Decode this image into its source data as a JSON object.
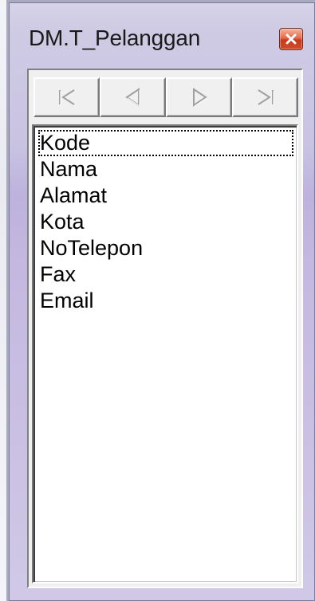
{
  "window": {
    "title": "DM.T_Pelanggan",
    "close_icon": "close-x-icon",
    "close_color": "#d9502e"
  },
  "navigator": {
    "buttons": [
      {
        "name": "first",
        "icon": "first-record-icon",
        "enabled": false
      },
      {
        "name": "prior",
        "icon": "prior-record-icon",
        "enabled": false
      },
      {
        "name": "next",
        "icon": "next-record-icon",
        "enabled": false
      },
      {
        "name": "last",
        "icon": "last-record-icon",
        "enabled": false
      }
    ]
  },
  "fields": {
    "items": [
      "Kode",
      "Nama",
      "Alamat",
      "Kota",
      "NoTelepon",
      "Fax",
      "Email"
    ],
    "focused_index": 0
  }
}
